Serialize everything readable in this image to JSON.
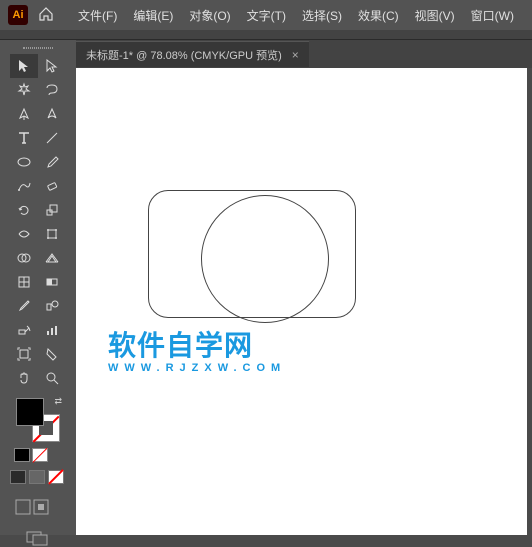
{
  "app": {
    "logo_text": "Ai",
    "menus": [
      {
        "label": "文件(F)"
      },
      {
        "label": "编辑(E)"
      },
      {
        "label": "对象(O)"
      },
      {
        "label": "文字(T)"
      },
      {
        "label": "选择(S)"
      },
      {
        "label": "效果(C)"
      },
      {
        "label": "视图(V)"
      },
      {
        "label": "窗口(W)"
      }
    ]
  },
  "doc_tab": {
    "title": "未标题-1* @ 78.08% (CMYK/GPU 预览)",
    "close": "×"
  },
  "tools": {
    "list": [
      "selection-tool",
      "direct-selection-tool",
      "magic-wand-tool",
      "lasso-tool",
      "pen-tool",
      "curvature-tool",
      "type-tool",
      "line-segment-tool",
      "ellipse-tool",
      "paintbrush-tool",
      "shaper-tool",
      "eraser-tool",
      "rotate-tool",
      "scale-tool",
      "width-tool",
      "free-transform-tool",
      "shape-builder-tool",
      "perspective-grid-tool",
      "mesh-tool",
      "gradient-tool",
      "eyedropper-tool",
      "blend-tool",
      "symbol-sprayer-tool",
      "column-graph-tool",
      "artboard-tool",
      "slice-tool",
      "hand-tool",
      "zoom-tool"
    ]
  },
  "watermark": {
    "text": "软件自学网",
    "url": "WWW.RJZXW.COM"
  },
  "colors": {
    "fill": "#000000",
    "stroke": "none"
  }
}
